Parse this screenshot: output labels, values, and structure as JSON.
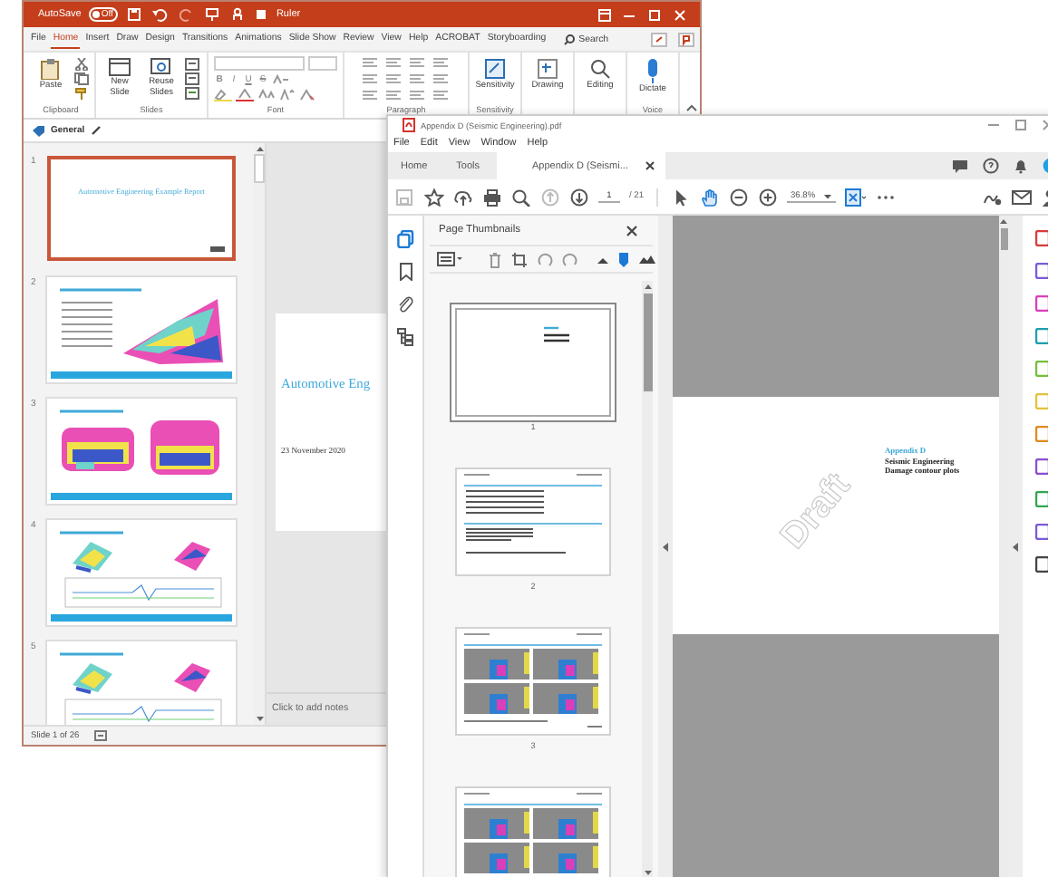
{
  "powerpoint": {
    "title_bar": {
      "autosave_label": "AutoSave",
      "autosave_state": "Off",
      "autosave_on": false,
      "title": "Ruler"
    },
    "ribbon_tabs": [
      {
        "label": "File",
        "selected": false
      },
      {
        "label": "Home",
        "selected": true
      },
      {
        "label": "Insert",
        "selected": false
      },
      {
        "label": "Draw",
        "selected": false
      },
      {
        "label": "Design",
        "selected": false
      },
      {
        "label": "Transitions",
        "selected": false
      },
      {
        "label": "Animations",
        "selected": false
      },
      {
        "label": "Slide Show",
        "selected": false
      },
      {
        "label": "Review",
        "selected": false
      },
      {
        "label": "View",
        "selected": false
      },
      {
        "label": "Help",
        "selected": false
      },
      {
        "label": "ACROBAT",
        "selected": false
      },
      {
        "label": "Storyboarding",
        "selected": false
      }
    ],
    "search": "Search",
    "ribbon_groups": [
      {
        "kind": "clipboard",
        "label": "Clipboard",
        "buttons": [
          "Paste"
        ]
      },
      {
        "kind": "slides",
        "label": "Slides",
        "buttons": [
          "New Slide",
          "Reuse Slides"
        ]
      },
      {
        "kind": "font",
        "label": "Font",
        "buttons": [
          "B",
          "I",
          "U",
          "S"
        ]
      },
      {
        "kind": "paragraph",
        "label": "Paragraph"
      },
      {
        "kind": "big",
        "label": "Sensitivity",
        "buttons": [
          "Sensitivity"
        ]
      },
      {
        "kind": "big",
        "buttons": [
          "Drawing"
        ]
      },
      {
        "kind": "big",
        "buttons": [
          "Editing"
        ]
      },
      {
        "kind": "voice",
        "label": "Voice",
        "buttons": [
          "Dictate"
        ]
      }
    ],
    "section": "General",
    "slides": [
      {
        "number": "1",
        "selected": true,
        "kind": "title",
        "title": "Automotive Engineering Example Report"
      },
      {
        "number": "2",
        "selected": false,
        "kind": "bullets"
      },
      {
        "number": "3",
        "selected": false,
        "kind": "cars"
      },
      {
        "number": "4",
        "selected": false,
        "kind": "chart"
      },
      {
        "number": "5",
        "selected": false,
        "kind": "chart"
      }
    ],
    "current_slide": {
      "title": "Automotive Eng",
      "date": "23 November 2020"
    },
    "notes_placeholder": "Click to add notes",
    "status": "Slide 1 of 26"
  },
  "acrobat": {
    "title": "Appendix D (Seismic Engineering).pdf",
    "menu": [
      "File",
      "Edit",
      "View",
      "Window",
      "Help"
    ],
    "tabs": [
      {
        "label": "Home",
        "selected": false
      },
      {
        "label": "Tools",
        "selected": false
      },
      {
        "label": "Appendix D (Seismi...",
        "selected": true,
        "closable": true
      }
    ],
    "page_number": "1",
    "page_count": "/ 21",
    "zoom": "36.8%",
    "panel_title": "Page Thumbnails",
    "thumbnails": [
      {
        "label": "1",
        "kind": "cover",
        "selected": true
      },
      {
        "label": "2",
        "kind": "contents",
        "selected": false
      },
      {
        "label": "3",
        "kind": "plots",
        "selected": false
      },
      {
        "kind": "plots",
        "selected": false
      }
    ],
    "page": {
      "heading": "Appendix D",
      "lines": [
        "Seismic Engineering",
        "Damage contour plots"
      ],
      "watermark": "Draft"
    }
  }
}
